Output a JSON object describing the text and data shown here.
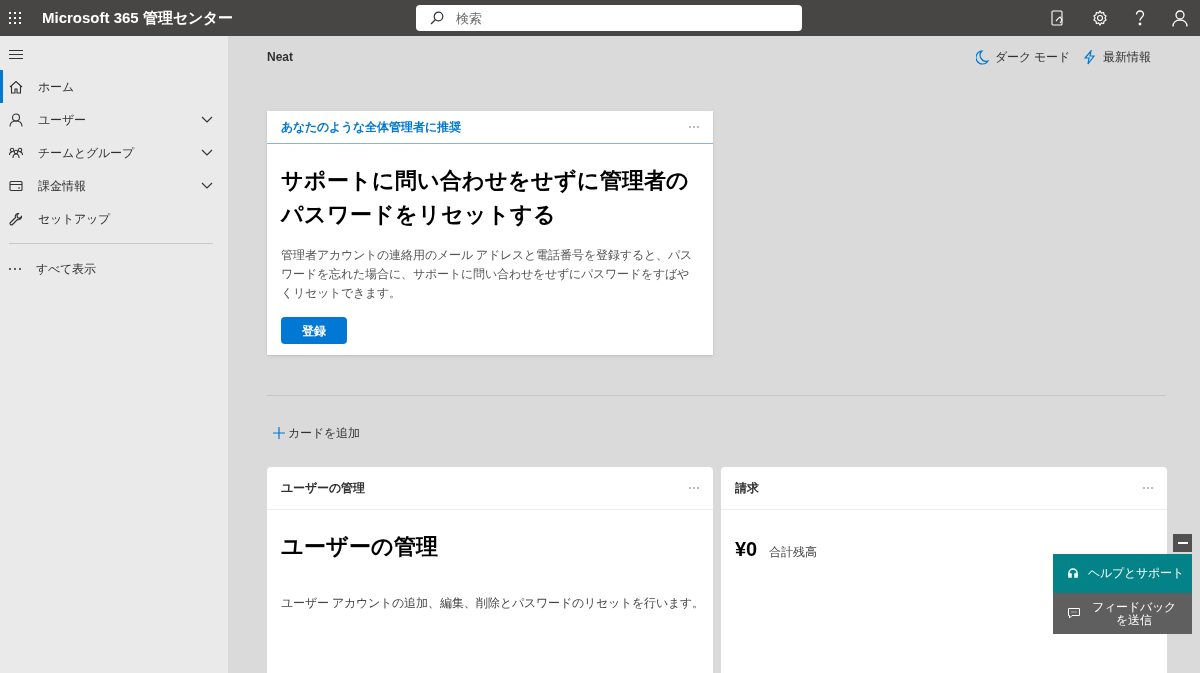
{
  "header": {
    "app_title": "Microsoft 365 管理センター",
    "search": {
      "placeholder": "検索"
    }
  },
  "sidebar": {
    "items": [
      {
        "label": "ホーム",
        "kind": "link",
        "selected": true
      },
      {
        "label": "ユーザー",
        "kind": "group",
        "selected": false
      },
      {
        "label": "チームとグループ",
        "kind": "group",
        "selected": false
      },
      {
        "label": "課金情報",
        "kind": "group",
        "selected": false
      },
      {
        "label": "セットアップ",
        "kind": "link",
        "selected": false
      }
    ],
    "show_all": "すべて表示"
  },
  "page": {
    "org_name": "Neat",
    "dark_mode": "ダーク モード",
    "whats_new": "最新情報"
  },
  "recommendation": {
    "label": "あなたのような全体管理者に推奨",
    "title": "サポートに問い合わせをせずに管理者のパスワードをリセットする",
    "body": "管理者アカウントの連絡用のメール アドレスと電話番号を登録すると、パスワードを忘れた場合に、サポートに問い合わせをせずにパスワードをすばやくリセットできます。",
    "button": "登録"
  },
  "add_card": "カードを追加",
  "cards": [
    {
      "kind": "text",
      "header": "ユーザーの管理",
      "title": "ユーザーの管理",
      "body": "ユーザー アカウントの追加、編集、削除とパスワードのリセットを行います。"
    },
    {
      "kind": "amount",
      "header": "請求",
      "amount": "¥0",
      "caption": "合計残高"
    }
  ],
  "help_panel": {
    "help": "ヘルプとサポート",
    "feedback": "フィードバックを送信"
  }
}
